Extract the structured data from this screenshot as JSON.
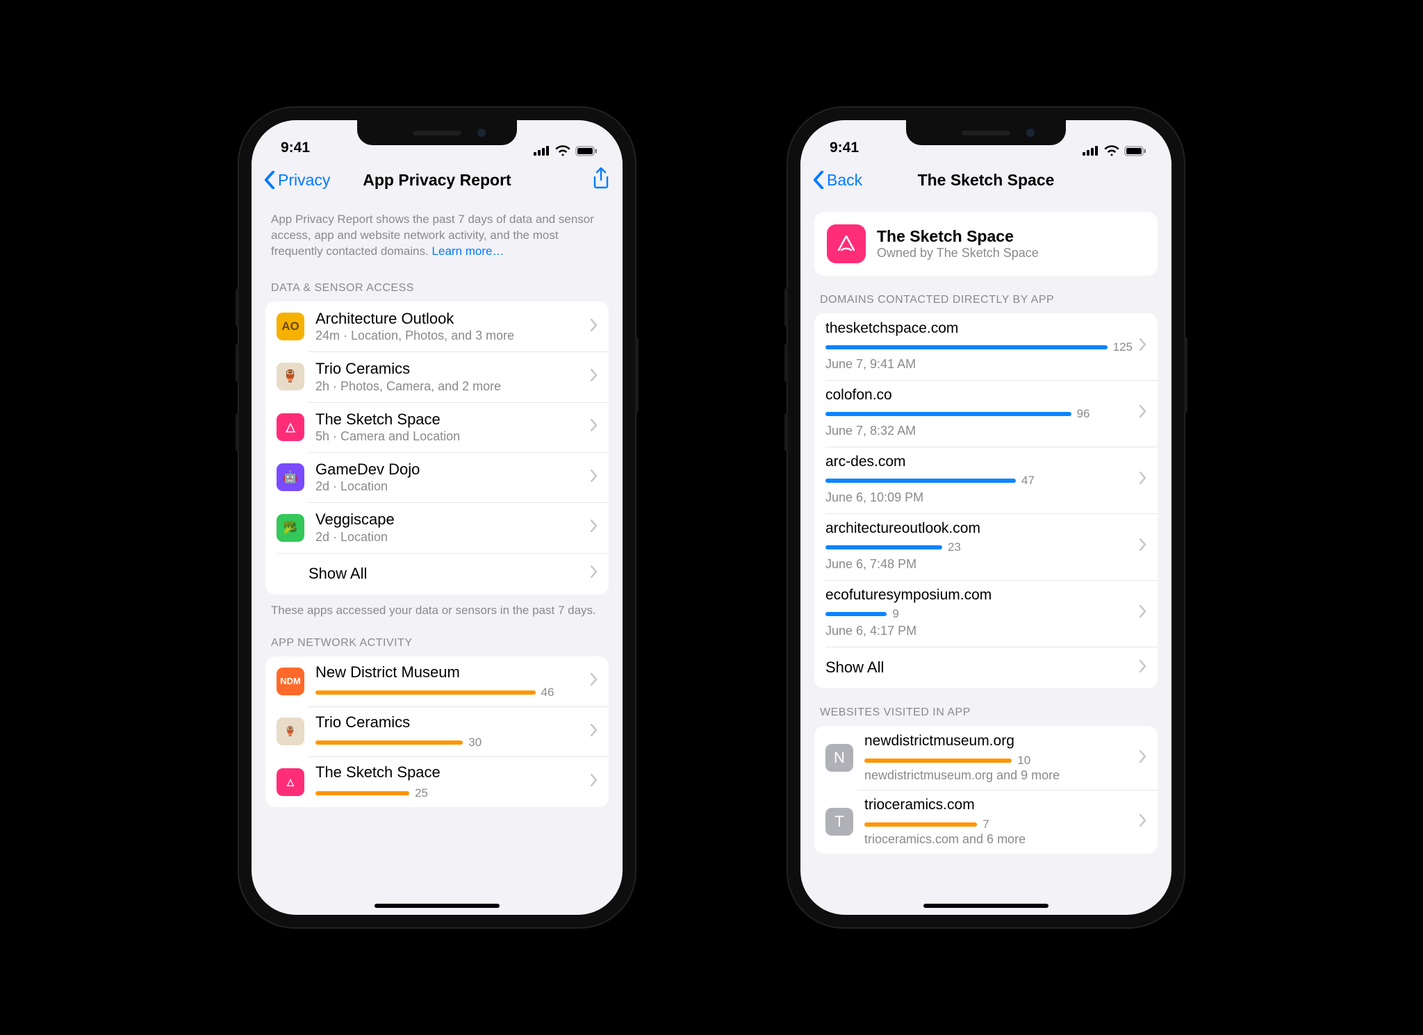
{
  "status": {
    "time": "9:41"
  },
  "left": {
    "back_label": "Privacy",
    "title": "App Privacy Report",
    "intro": "App Privacy Report shows the past 7 days of data and sensor access, app and website network activity, and the most frequently contacted domains.",
    "learn_more": "Learn more…",
    "section_data_header": "DATA & SENSOR ACCESS",
    "apps": [
      {
        "name": "Architecture Outlook",
        "sub": "24m · Location, Photos, and 3 more",
        "icon_text": "AO",
        "icon_bg": "#f6b100",
        "icon_fg": "#6b4a00"
      },
      {
        "name": "Trio Ceramics",
        "sub": "2h · Photos, Camera, and 2 more",
        "icon_text": "🏺",
        "icon_bg": "#e8dcc8",
        "icon_fg": "#6b5a3a"
      },
      {
        "name": "The Sketch Space",
        "sub": "5h · Camera and Location",
        "icon_text": "△",
        "icon_bg": "#ff2d78",
        "icon_fg": "#fff"
      },
      {
        "name": "GameDev Dojo",
        "sub": "2d · Location",
        "icon_text": "🤖",
        "icon_bg": "#7a4bff",
        "icon_fg": "#fff"
      },
      {
        "name": "Veggiscape",
        "sub": "2d · Location",
        "icon_text": "🥦",
        "icon_bg": "#34c759",
        "icon_fg": "#fff"
      }
    ],
    "show_all": "Show All",
    "data_footer": "These apps accessed your data or sensors in the past 7 days.",
    "section_network_header": "APP NETWORK ACTIVITY",
    "network": [
      {
        "name": "New District Museum",
        "value": 46,
        "icon_text": "NDM",
        "icon_bg": "#ff6a2b",
        "bar_color": "#ff9500",
        "bar_pct": 82
      },
      {
        "name": "Trio Ceramics",
        "value": 30,
        "icon_text": "🏺",
        "icon_bg": "#e8dcc8",
        "bar_color": "#ff9500",
        "bar_pct": 55
      },
      {
        "name": "The Sketch Space",
        "value": 25,
        "icon_text": "△",
        "icon_bg": "#ff2d78",
        "bar_color": "#ff9500",
        "bar_pct": 35
      }
    ]
  },
  "right": {
    "back_label": "Back",
    "title": "The Sketch Space",
    "app": {
      "name": "The Sketch Space",
      "owner": "Owned by The Sketch Space",
      "icon_text": "△",
      "icon_bg": "#ff2d78"
    },
    "domains_header": "DOMAINS CONTACTED DIRECTLY BY APP",
    "domains": [
      {
        "name": "thesketchspace.com",
        "value": 125,
        "time": "June 7, 9:41 AM",
        "bar_pct": 92
      },
      {
        "name": "colofon.co",
        "value": 96,
        "time": "June 7, 8:32 AM",
        "bar_pct": 80
      },
      {
        "name": "arc-des.com",
        "value": 47,
        "time": "June 6, 10:09 PM",
        "bar_pct": 62
      },
      {
        "name": "architectureoutlook.com",
        "value": 23,
        "time": "June 6, 7:48 PM",
        "bar_pct": 38
      },
      {
        "name": "ecofuturesymposium.com",
        "value": 9,
        "time": "June 6, 4:17 PM",
        "bar_pct": 20
      }
    ],
    "show_all": "Show All",
    "domain_bar_color": "#0a84ff",
    "websites_header": "WEBSITES VISITED IN APP",
    "websites": [
      {
        "letter": "N",
        "name": "newdistrictmuseum.org",
        "value": 10,
        "sub": "newdistrictmuseum.org and 9 more",
        "bar_pct": 55
      },
      {
        "letter": "T",
        "name": "trioceramics.com",
        "value": 7,
        "sub": "trioceramics.com and 6 more",
        "bar_pct": 42
      }
    ],
    "website_bar_color": "#ff9500"
  }
}
